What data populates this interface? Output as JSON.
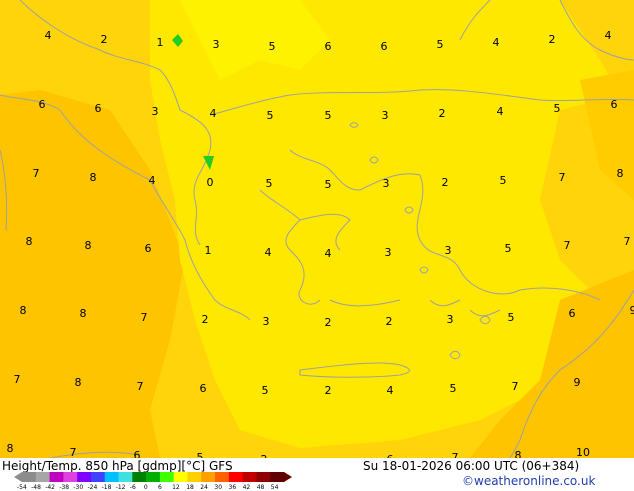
{
  "footer": {
    "title": "Height/Temp. 850 hPa [gdmp][°C] GFS",
    "datetime": "Su 18-01-2026 06:00 UTC (06+384)",
    "credit": "©weatheronline.co.uk"
  },
  "colorbar": {
    "ticks": [
      "-54",
      "-48",
      "-42",
      "-38",
      "-30",
      "-24",
      "-18",
      "-12",
      "-6",
      "0",
      "6",
      "12",
      "18",
      "24",
      "30",
      "36",
      "42",
      "48",
      "54"
    ],
    "colors": [
      "#8c8c8c",
      "#a6a6a6",
      "#c000c0",
      "#e040e0",
      "#8000ff",
      "#4040ff",
      "#00c0ff",
      "#40e0e0",
      "#008000",
      "#00b000",
      "#40ff00",
      "#ffff00",
      "#ffd000",
      "#ffa000",
      "#ff6000",
      "#ff0000",
      "#c00000",
      "#900000",
      "#600000"
    ]
  },
  "temperature_labels": [
    "4",
    "2",
    "1",
    "3",
    "5",
    "6",
    "6",
    "5",
    "4",
    "2",
    "4",
    "6",
    "6",
    "3",
    "4",
    "5",
    "5",
    "3",
    "2",
    "4",
    "5",
    "6",
    "7",
    "8",
    "4",
    "0",
    "5",
    "5",
    "3",
    "2",
    "5",
    "7",
    "8",
    "8",
    "8",
    "6",
    "1",
    "4",
    "4",
    "3",
    "3",
    "5",
    "7",
    "7",
    "8",
    "8",
    "7",
    "2",
    "3",
    "2",
    "2",
    "3",
    "5",
    "6",
    "9",
    "7",
    "8",
    "7",
    "6",
    "5",
    "2",
    "4",
    "5",
    "7",
    "9",
    "8",
    "7",
    "6",
    "5",
    "2",
    "6",
    "7",
    "8",
    "10"
  ],
  "colors": {
    "yellow_light": "#fff200",
    "yellow": "#ffe000",
    "orange_yellow": "#ffd000",
    "coast": "#a0a0a0",
    "marker_green": "#22cc22"
  }
}
